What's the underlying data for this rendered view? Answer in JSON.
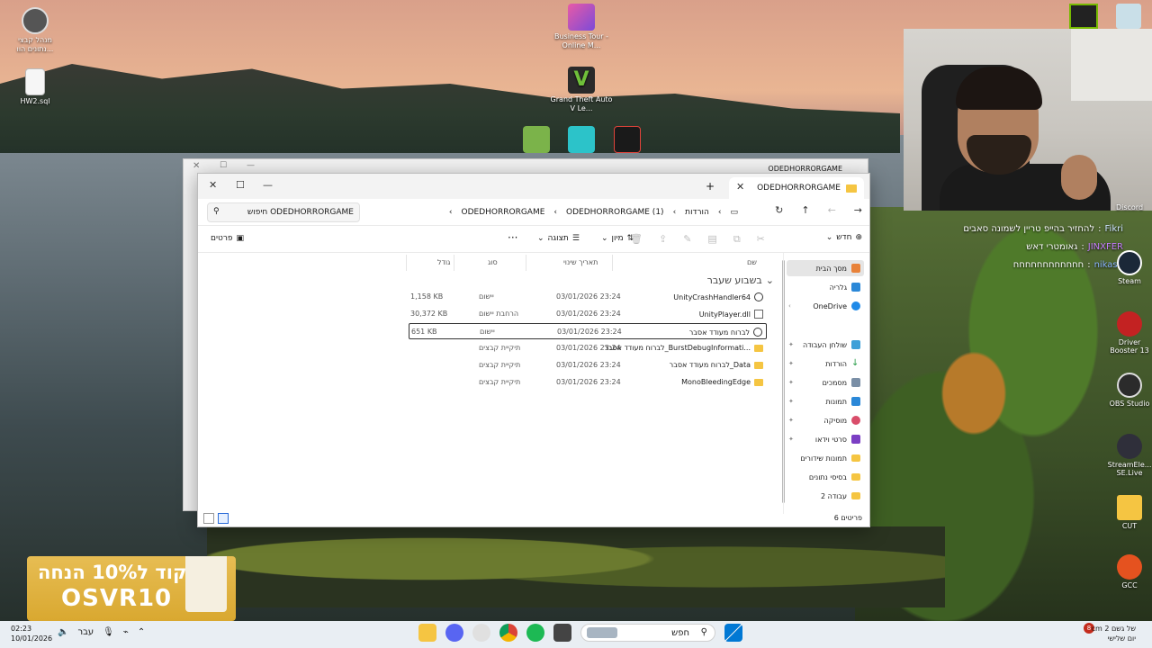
{
  "desktop": {
    "icons_left": [
      {
        "label": "מנהל קבצי\nנתונים הוו...",
        "icon": "app-icon"
      },
      {
        "label": "HW2.sql",
        "icon": "file-icon"
      }
    ],
    "icons_center": [
      {
        "label": "Business Tour - Online M...",
        "icon": "game-icon"
      },
      {
        "label": "Grand Theft Auto V Le...",
        "icon": "gta-icon"
      }
    ],
    "icons_right": [
      {
        "label": "Discord",
        "icon": "discord-icon"
      },
      {
        "label": "Steam",
        "icon": "steam-icon"
      },
      {
        "label": "Driver Booster 13",
        "icon": "driver-booster-icon"
      },
      {
        "label": "OBS Studio",
        "icon": "obs-icon"
      },
      {
        "label": "StreamEle... SE.Live",
        "icon": "streamelements-icon"
      },
      {
        "label": "CUT",
        "icon": "folder-icon"
      },
      {
        "label": "GCC",
        "icon": "gcc-icon"
      }
    ]
  },
  "chat": [
    {
      "user": "Fikri",
      "text": "להחזיר בהייפ טריין לשמונה סאבים"
    },
    {
      "user": "JINXFER",
      "text": "גאומטרי דאש"
    },
    {
      "user": "nikas4",
      "text": "חחחחחחחחחחחח"
    }
  ],
  "back_window": {
    "tab_title": "ODEDHORRORGAME"
  },
  "explorer": {
    "tab_title": "ODEDHORRORGAME",
    "search_placeholder": "חיפוש ODEDHORRORGAME",
    "breadcrumb": [
      "הורדות",
      "ODEDHORRORGAME (1)",
      "ODEDHORRORGAME"
    ],
    "toolbar": {
      "new_label": "חדש",
      "sort_label": "מיון",
      "view_label": "תצוגה",
      "details_label": "פרטים"
    },
    "columns": {
      "name": "שם",
      "date": "תאריך שינוי",
      "type": "סוג",
      "size": "גודל"
    },
    "group_header": "בשבוע שעבר",
    "files": [
      {
        "name": "UnityCrashHandler64",
        "date": "03/01/2026 23:24",
        "type": "יישום",
        "size": "1,158 KB",
        "icon": "exe"
      },
      {
        "name": "UnityPlayer.dll",
        "date": "03/01/2026 23:24",
        "type": "הרחבת יישום",
        "size": "30,372 KB",
        "icon": "dll"
      },
      {
        "name": "לברוח מעודד אסבר",
        "date": "03/01/2026 23:24",
        "type": "יישום",
        "size": "651 KB",
        "icon": "exe"
      },
      {
        "name": "לברוח מעודד אסבר_BurstDebugInformati...",
        "date": "03/01/2026 23:24",
        "type": "תיקיית קבצים",
        "size": "",
        "icon": "folder"
      },
      {
        "name": "לברוח מעודד אסבר_Data",
        "date": "03/01/2026 23:24",
        "type": "תיקיית קבצים",
        "size": "",
        "icon": "folder"
      },
      {
        "name": "MonoBleedingEdge",
        "date": "03/01/2026 23:24",
        "type": "תיקיית קבצים",
        "size": "",
        "icon": "folder"
      }
    ],
    "sidebar": [
      {
        "label": "מסך הבית",
        "icon": "home-icon"
      },
      {
        "label": "גלריה",
        "icon": "gallery-icon"
      },
      {
        "label": "OneDrive",
        "icon": "onedrive-icon"
      },
      {
        "label": "שולחן העבודה",
        "icon": "desktop-icon"
      },
      {
        "label": "הורדות",
        "icon": "download-icon"
      },
      {
        "label": "מסמכים",
        "icon": "documents-icon"
      },
      {
        "label": "תמונות",
        "icon": "pictures-icon"
      },
      {
        "label": "מוסיקה",
        "icon": "music-icon"
      },
      {
        "label": "סרטי וידאו",
        "icon": "videos-icon"
      },
      {
        "label": "תמונות שידורים",
        "icon": "folder-icon"
      },
      {
        "label": "בסיסי נתונים",
        "icon": "folder-icon"
      },
      {
        "label": "עבודה 2",
        "icon": "folder-icon"
      }
    ],
    "status_count": "6 פריטים"
  },
  "ad": {
    "line1": "קוד ל10% הנחה",
    "line2": "OSVR10"
  },
  "taskbar": {
    "time": "02:23",
    "date": "10/01/2026",
    "lang": "עבר",
    "search_label": "חפש",
    "weather_line1": "של גשם 2 cm",
    "weather_line2": "יום שלישי",
    "badge": "8"
  }
}
